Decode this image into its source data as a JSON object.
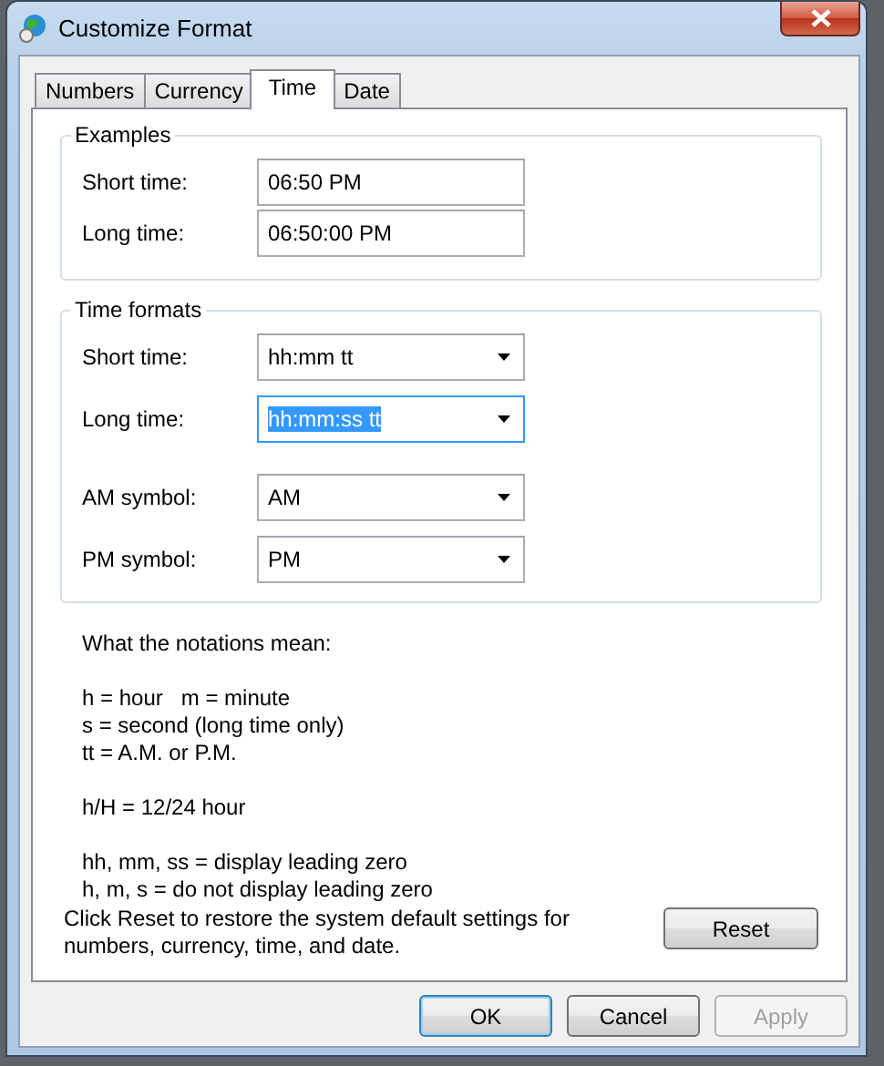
{
  "window": {
    "title": "Customize Format"
  },
  "tabs": [
    {
      "label": "Numbers",
      "selected": false
    },
    {
      "label": "Currency",
      "selected": false
    },
    {
      "label": "Time",
      "selected": true
    },
    {
      "label": "Date",
      "selected": false
    }
  ],
  "examples": {
    "title": "Examples",
    "fields": [
      {
        "label": "Short time:",
        "value": "06:50 PM"
      },
      {
        "label": "Long time:",
        "value": "06:50:00 PM"
      }
    ]
  },
  "time_formats": {
    "title": "Time formats",
    "fields": [
      {
        "label": "Short time:",
        "value": "hh:mm tt",
        "focused": false
      },
      {
        "label": "Long time:",
        "value": "hh:mm:ss tt",
        "focused": true
      },
      {
        "label": "AM symbol:",
        "value": "AM",
        "focused": false
      },
      {
        "label": "PM symbol:",
        "value": "PM",
        "focused": false
      }
    ]
  },
  "notes": {
    "heading": "What the notations mean:",
    "paragraphs": [
      [
        "h = hour   m = minute",
        "s = second (long time only)",
        "tt = A.M. or P.M."
      ],
      [
        "h/H = 12/24 hour"
      ],
      [
        "hh, mm, ss = display leading zero",
        "h, m, s = do not display leading zero"
      ]
    ]
  },
  "reset": {
    "text": "Click Reset to restore the system default settings for numbers, currency, time, and date.",
    "button": "Reset"
  },
  "buttons": [
    {
      "label": "OK",
      "default": true,
      "disabled": false
    },
    {
      "label": "Cancel",
      "default": false,
      "disabled": false
    },
    {
      "label": "Apply",
      "default": false,
      "disabled": true
    }
  ]
}
